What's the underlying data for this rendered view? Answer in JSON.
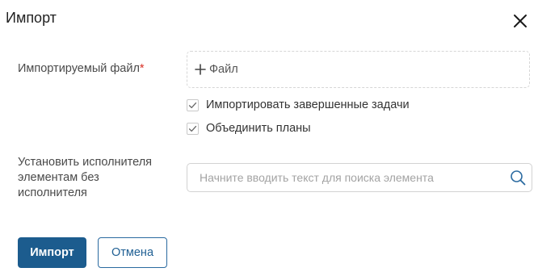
{
  "dialog": {
    "title": "Импорт",
    "close_icon": "close-icon"
  },
  "fields": {
    "file": {
      "label": "Импортируемый файл",
      "required_mark": "*",
      "button_label": "Файл",
      "icon": "plus-icon"
    },
    "options": [
      {
        "label": "Импортировать завершенные задачи",
        "checked": true
      },
      {
        "label": "Объединить планы",
        "checked": true
      }
    ],
    "assignee": {
      "label_line1": "Установить исполнителя",
      "label_line2": "элементам без",
      "label_line3": "исполнителя",
      "placeholder": "Начните вводить текст для поиска элемента",
      "value": "",
      "icon": "search-icon"
    }
  },
  "actions": {
    "import_label": "Импорт",
    "cancel_label": "Отмена"
  },
  "colors": {
    "primary": "#1c5c8e",
    "required": "#d93025"
  }
}
